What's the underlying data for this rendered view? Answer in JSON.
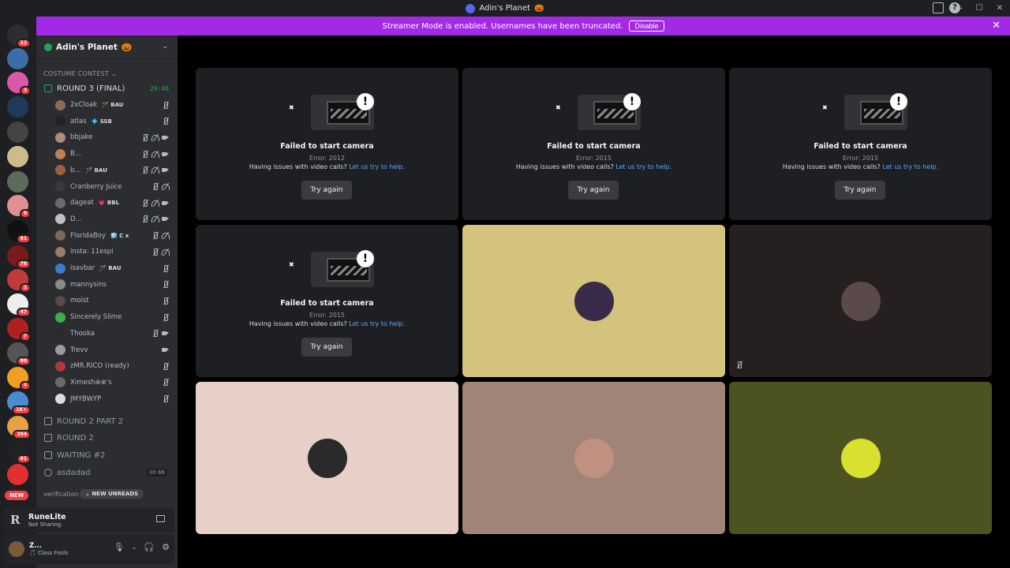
{
  "window": {
    "title": "Adin's Planet",
    "title_emoji": "🎃"
  },
  "banner": {
    "text": "Streamer Mode is enabled. Usernames have been truncated.",
    "button": "Disable"
  },
  "guilds": [
    {
      "badge": "12",
      "color": "#2b2d31"
    },
    {
      "badge": "",
      "color": "#3b6ea8"
    },
    {
      "badge": "3",
      "color": "#d958a8"
    },
    {
      "badge": "",
      "color": "#1f3a5a"
    },
    {
      "badge": "",
      "color": "#444"
    },
    {
      "badge": "",
      "color": "#cdbb8a"
    },
    {
      "badge": "",
      "color": "#5b6b5b"
    },
    {
      "badge": "9",
      "color": "#e09090"
    },
    {
      "badge": "91",
      "color": "#111"
    },
    {
      "badge": "78",
      "color": "#7a1a1a"
    },
    {
      "badge": "2",
      "color": "#c23a3a"
    },
    {
      "badge": "47",
      "color": "#eeeeee"
    },
    {
      "badge": "7",
      "color": "#b02020"
    },
    {
      "badge": "80",
      "color": "#555"
    },
    {
      "badge": "4",
      "color": "#f0a020"
    },
    {
      "badge": "1K+",
      "color": "#4b8bd0"
    },
    {
      "badge": "294",
      "color": "#e8a040"
    },
    {
      "badge": "61",
      "color": "#222"
    },
    {
      "badge": "",
      "color": "#e03030"
    }
  ],
  "guild_new": "NEW",
  "server": {
    "name": "Adin's Planet",
    "emoji": "🎃"
  },
  "category": "COSTUME CONTEST",
  "active_channel": {
    "name": "ROUND 3 (FINAL)",
    "timer": "29:40"
  },
  "members": [
    {
      "name": "2xCloak",
      "tag": "🪄 BAU",
      "color": "#8a6a5a",
      "mute": true,
      "deaf": false,
      "cam": false
    },
    {
      "name": "atlas",
      "tag": "💠 SSB",
      "color": "#222",
      "mute": true,
      "deaf": false,
      "cam": false
    },
    {
      "name": "bbjake",
      "tag": "",
      "color": "#b08a7a",
      "mute": true,
      "deaf": true,
      "cam": true
    },
    {
      "name": "B...",
      "tag": "",
      "color": "#c08050",
      "mute": true,
      "deaf": true,
      "cam": true
    },
    {
      "name": "b...",
      "tag": "🪄 BAU",
      "color": "#a06040",
      "mute": true,
      "deaf": true,
      "cam": true
    },
    {
      "name": "Cranberry Juice",
      "tag": "",
      "color": "#3a3a3a",
      "mute": true,
      "deaf": true,
      "cam": false
    },
    {
      "name": "dageat",
      "tag": "💗 BBL",
      "color": "#6a6a6a",
      "mute": true,
      "deaf": true,
      "cam": true
    },
    {
      "name": "D...",
      "tag": "",
      "color": "#c0c0c0",
      "mute": true,
      "deaf": true,
      "cam": true
    },
    {
      "name": "FloridaBoy",
      "tag": "🧊 C x",
      "color": "#7a6a5a",
      "mute": true,
      "deaf": true,
      "cam": false
    },
    {
      "name": "insta: 11espi",
      "tag": "",
      "color": "#9a7a6a",
      "mute": true,
      "deaf": true,
      "cam": false
    },
    {
      "name": "isavbar",
      "tag": "🪄 BAU",
      "color": "#3a7ad0",
      "mute": true,
      "deaf": false,
      "cam": false
    },
    {
      "name": "mannysins",
      "tag": "",
      "color": "#8a8a8a",
      "mute": true,
      "deaf": false,
      "cam": false
    },
    {
      "name": "moist",
      "tag": "",
      "color": "#5a4a4a",
      "mute": true,
      "deaf": false,
      "cam": false
    },
    {
      "name": "Sincerely Slime",
      "tag": "",
      "color": "#3ab04a",
      "mute": true,
      "deaf": false,
      "cam": false
    },
    {
      "name": "Thooka",
      "tag": "",
      "color": "#2a2a2a",
      "mute": true,
      "deaf": false,
      "cam": true
    },
    {
      "name": "Trevv",
      "tag": "",
      "color": "#9a9a9a",
      "mute": false,
      "deaf": false,
      "cam": true
    },
    {
      "name": "zMR.RICO (ready)",
      "tag": "",
      "color": "#b03a3a",
      "mute": true,
      "deaf": false,
      "cam": false
    },
    {
      "name": "Ximesh⊕⊕'s",
      "tag": "",
      "color": "#6a6a6a",
      "mute": true,
      "deaf": false,
      "cam": false
    },
    {
      "name": "JMYBWYP",
      "tag": "",
      "color": "#ddd",
      "mute": true,
      "deaf": false,
      "cam": false
    }
  ],
  "other_channels": [
    {
      "name": "ROUND 2 PART 2",
      "icon": "lock"
    },
    {
      "name": "ROUND 2",
      "icon": "lock"
    },
    {
      "name": "WAITING #2",
      "icon": "lock"
    },
    {
      "name": "asdadad",
      "icon": "speaker",
      "counts": "00  66"
    }
  ],
  "verification": "verification",
  "new_unreads": "NEW UNREADS",
  "activity": {
    "title": "RuneLite",
    "subtitle": "Not Sharing"
  },
  "user": {
    "name": "Z...",
    "status": "🎵 Class Fools"
  },
  "error_tiles": [
    {
      "title": "Failed to start camera",
      "code": "Error: 2012",
      "help": "Having issues with video calls?",
      "link": "Let us try to help.",
      "button": "Try again"
    },
    {
      "title": "Failed to start camera",
      "code": "Error: 2015",
      "help": "Having issues with video calls?",
      "link": "Let us try to help.",
      "button": "Try again"
    },
    {
      "title": "Failed to start camera",
      "code": "Error: 2015",
      "help": "Having issues with video calls?",
      "link": "Let us try to help.",
      "button": "Try again"
    },
    {
      "title": "Failed to start camera",
      "code": "Error: 2015",
      "help": "Having issues with video calls?",
      "link": "Let us try to help.",
      "button": "Try again"
    }
  ],
  "avatar_tiles": [
    {
      "bg": "#d4c37c",
      "avatar": "#3a2a4a",
      "muted": false
    },
    {
      "bg": "#261f1f",
      "avatar": "#5a4a4a",
      "muted": true
    },
    {
      "bg": "#e6d0c8",
      "avatar": "#2a2a2a",
      "muted": false
    },
    {
      "bg": "#a08478",
      "avatar": "#c09080",
      "muted": false
    },
    {
      "bg": "#4d5320",
      "avatar": "#d8e030",
      "muted": false
    }
  ]
}
